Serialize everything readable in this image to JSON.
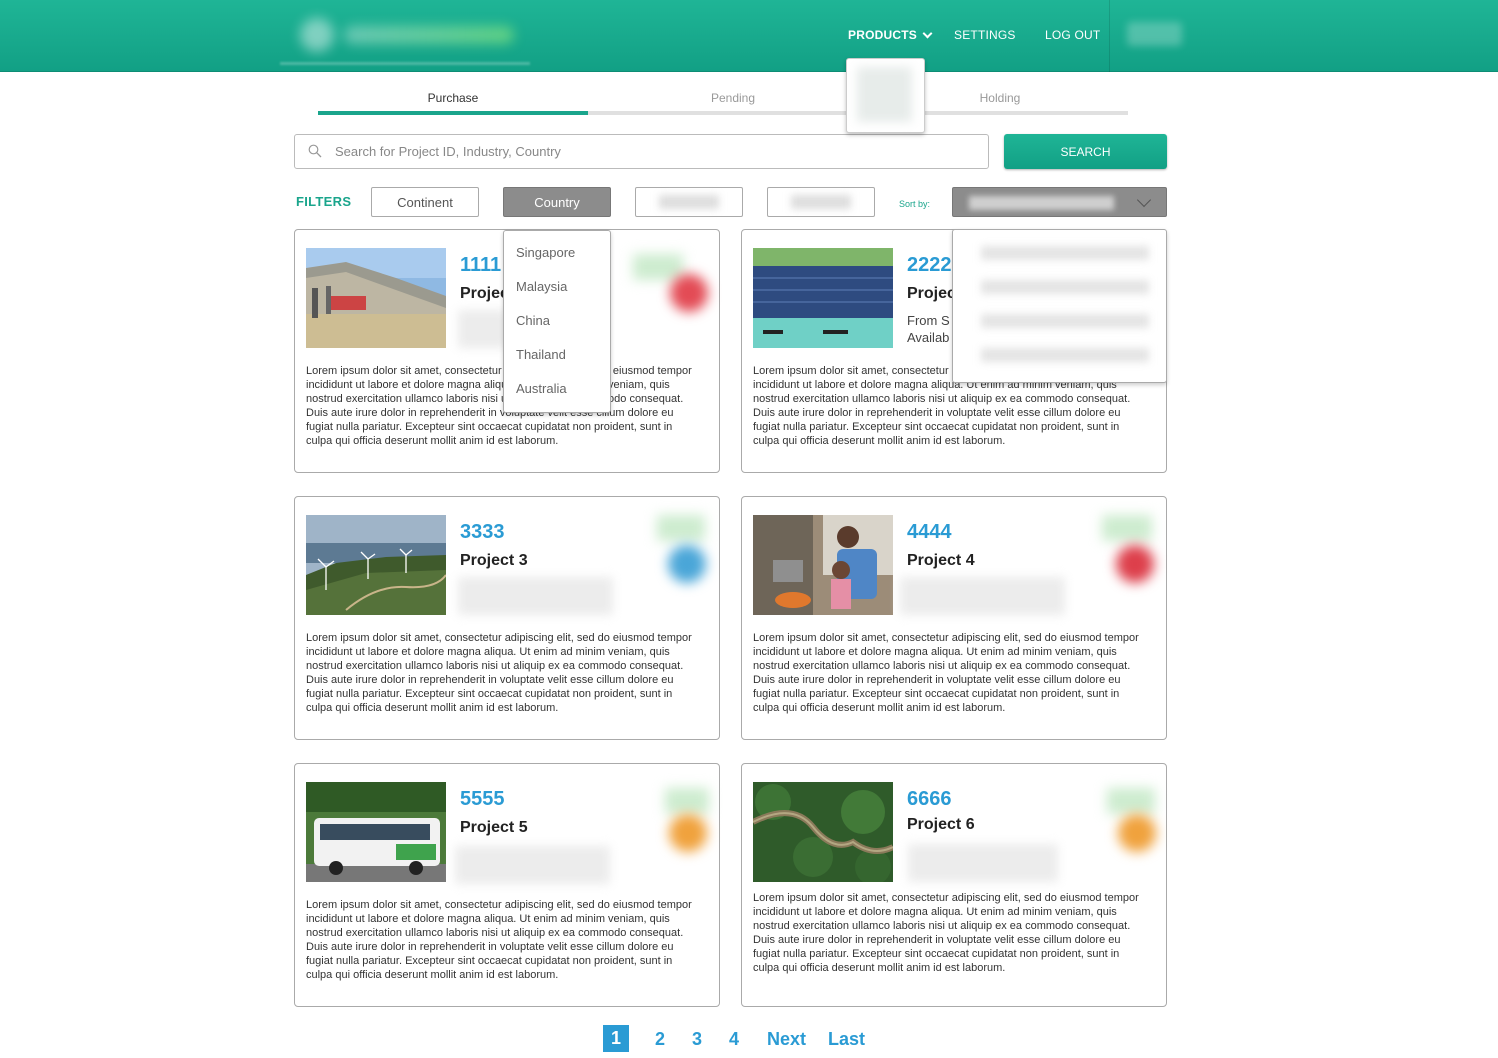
{
  "header": {
    "nav": {
      "products": "PRODUCTS",
      "settings": "SETTINGS",
      "logout": "LOG OUT"
    }
  },
  "tabs": [
    {
      "label": "Purchase",
      "active": true
    },
    {
      "label": "Pending",
      "active": false
    },
    {
      "label": "Holding",
      "active": false
    }
  ],
  "search": {
    "placeholder": "Search for Project ID, Industry, Country",
    "button": "SEARCH"
  },
  "filters": {
    "label": "FILTERS",
    "continent": "Continent",
    "country": "Country",
    "sort_label": "Sort by:"
  },
  "country_menu": [
    "Singapore",
    "Malaysia",
    "China",
    "Thailand",
    "Australia"
  ],
  "projects": [
    {
      "id": "1111",
      "title": "Projec",
      "desc": "Lorem ipsum dolor sit amet, consectetur adipiscing elit, sed do eiusmod tempor incididunt ut labore et dolore magna aliqua. Ut enim ad minim veniam, quis nostrud exercitation ullamco laboris nisi ut aliquip ex ea commodo consequat. Duis aute irure dolor in reprehenderit in voluptate velit esse cillum dolore eu fugiat nulla pariatur. Excepteur sint occaecat cupidatat non proident, sunt in culpa qui officia deserunt mollit anim id est laborum.",
      "badge_color": "#e34b55"
    },
    {
      "id": "2222",
      "title": "Projec",
      "sub1": "From S",
      "sub2": "Availab",
      "desc": "Lorem ipsum dolor sit amet, consectetur adipiscing elit, sed do eiusmod tempor incididunt ut labore et dolore magna aliqua. Ut enim ad minim veniam, quis nostrud exercitation ullamco laboris nisi ut aliquip ex ea commodo consequat. Duis aute irure dolor in reprehenderit in voluptate velit esse cillum dolore eu fugiat nulla pariatur. Excepteur sint occaecat cupidatat non proident, sunt in culpa qui officia deserunt mollit anim id est laborum."
    },
    {
      "id": "3333",
      "title": "Project 3",
      "desc": "Lorem ipsum dolor sit amet, consectetur adipiscing elit, sed do eiusmod tempor incididunt ut labore et dolore magna aliqua. Ut enim ad minim veniam, quis nostrud exercitation ullamco laboris nisi ut aliquip ex ea commodo consequat. Duis aute irure dolor in reprehenderit in voluptate velit esse cillum dolore eu fugiat nulla pariatur. Excepteur sint occaecat cupidatat non proident, sunt in culpa qui officia deserunt mollit anim id est laborum.",
      "badge_color": "#4aa6d8"
    },
    {
      "id": "4444",
      "title": "Project 4",
      "desc": "Lorem ipsum dolor sit amet, consectetur adipiscing elit, sed do eiusmod tempor incididunt ut labore et dolore magna aliqua. Ut enim ad minim veniam, quis nostrud exercitation ullamco laboris nisi ut aliquip ex ea commodo consequat. Duis aute irure dolor in reprehenderit in voluptate velit esse cillum dolore eu fugiat nulla pariatur. Excepteur sint occaecat cupidatat non proident, sunt in culpa qui officia deserunt mollit anim id est laborum.",
      "badge_color": "#dd3f4b"
    },
    {
      "id": "5555",
      "title": "Project 5",
      "desc": "Lorem ipsum dolor sit amet, consectetur adipiscing elit, sed do eiusmod tempor incididunt ut labore et dolore magna aliqua. Ut enim ad minim veniam, quis nostrud exercitation ullamco laboris nisi ut aliquip ex ea commodo consequat. Duis aute irure dolor in reprehenderit in voluptate velit esse cillum dolore eu fugiat nulla pariatur. Excepteur sint occaecat cupidatat non proident, sunt in culpa qui officia deserunt mollit anim id est laborum.",
      "badge_color": "#f0a23d"
    },
    {
      "id": "6666",
      "title": "Project 6",
      "desc": "Lorem ipsum dolor sit amet, consectetur adipiscing elit, sed do eiusmod tempor incididunt ut labore et dolore magna aliqua. Ut enim ad minim veniam, quis nostrud exercitation ullamco laboris nisi ut aliquip ex ea commodo consequat. Duis aute irure dolor in reprehenderit in voluptate velit esse cillum dolore eu fugiat nulla pariatur. Excepteur sint occaecat cupidatat non proident, sunt in culpa qui officia deserunt mollit anim id est laborum.",
      "badge_color": "#f0a23d"
    }
  ],
  "pagination": {
    "pages": [
      "1",
      "2",
      "3",
      "4"
    ],
    "next": "Next",
    "last": "Last",
    "current": "1"
  }
}
